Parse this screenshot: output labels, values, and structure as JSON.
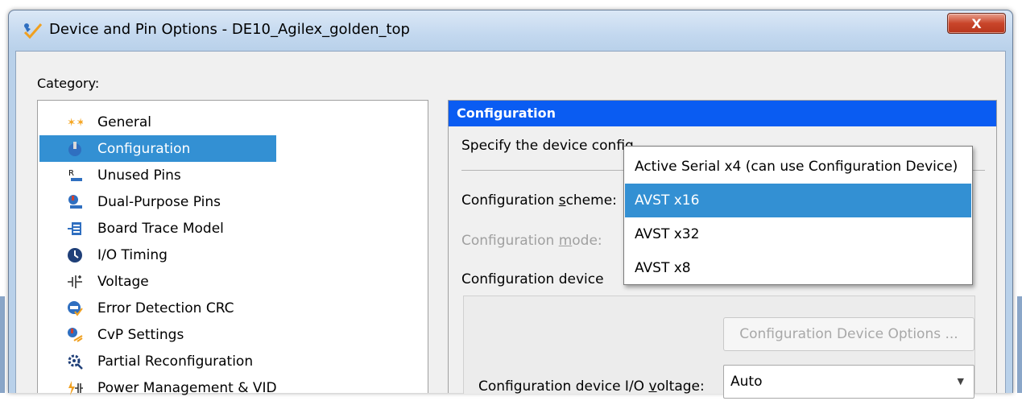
{
  "window": {
    "title": "Device and Pin Options - DE10_Agilex_golden_top",
    "close_label": "X"
  },
  "category": {
    "label": "Category:",
    "items": [
      {
        "label": "General",
        "icon": "general-star-icon"
      },
      {
        "label": "Configuration",
        "icon": "configuration-icon",
        "selected": true
      },
      {
        "label": "Unused Pins",
        "icon": "unused-pins-icon"
      },
      {
        "label": "Dual-Purpose Pins",
        "icon": "dual-purpose-pins-icon"
      },
      {
        "label": "Board Trace Model",
        "icon": "board-trace-model-icon"
      },
      {
        "label": "I/O Timing",
        "icon": "clock-icon"
      },
      {
        "label": "Voltage",
        "icon": "voltage-icon"
      },
      {
        "label": "Error Detection CRC",
        "icon": "crc-icon"
      },
      {
        "label": "CvP Settings",
        "icon": "cvp-icon"
      },
      {
        "label": "Partial Reconfiguration",
        "icon": "partial-reconfig-icon"
      },
      {
        "label": "Power Management & VID",
        "icon": "power-icon"
      }
    ]
  },
  "panel": {
    "header": "Configuration",
    "description": "Specify the device config",
    "scheme_label_pre": "Configuration ",
    "scheme_label_u": "s",
    "scheme_label_post": "cheme:",
    "mode_label_pre": "Configuration ",
    "mode_label_u": "m",
    "mode_label_post": "ode:",
    "device_label": "Configuration device",
    "device_options_button": "Configuration Device Options ...",
    "voltage_label_pre": "Configuration device I/O ",
    "voltage_label_u": "v",
    "voltage_label_post": "oltage:",
    "voltage_value": "Auto"
  },
  "dropdown": {
    "options": [
      {
        "label": "Active Serial x4 (can use Configuration Device)"
      },
      {
        "label": "AVST x16",
        "selected": true
      },
      {
        "label": "AVST x32"
      },
      {
        "label": "AVST x8"
      }
    ]
  },
  "colors": {
    "selection": "#3390d3",
    "panel_header": "#0a5cf2"
  }
}
